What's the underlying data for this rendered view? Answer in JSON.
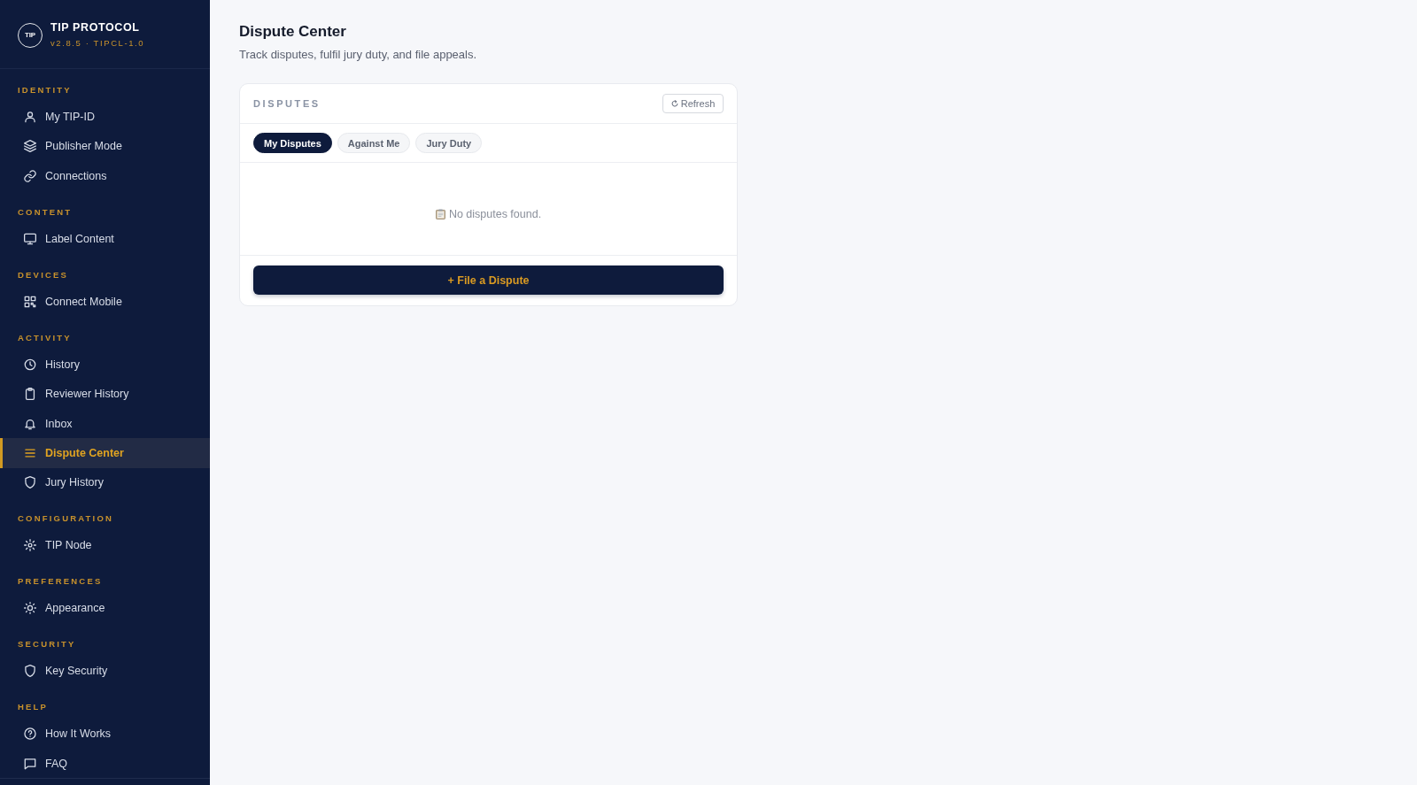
{
  "brand": {
    "logo_text": "TIP",
    "title": "TIP PROTOCOL",
    "version": "v2.8.5 · TIPCL-1.0"
  },
  "sidebar": {
    "sections": [
      {
        "title": "IDENTITY",
        "items": [
          {
            "label": "My TIP-ID",
            "selected": false
          },
          {
            "label": "Publisher Mode",
            "selected": false
          },
          {
            "label": "Connections",
            "selected": false
          }
        ]
      },
      {
        "title": "CONTENT",
        "items": [
          {
            "label": "Label Content",
            "selected": false
          }
        ]
      },
      {
        "title": "DEVICES",
        "items": [
          {
            "label": "Connect Mobile",
            "selected": false
          }
        ]
      },
      {
        "title": "ACTIVITY",
        "items": [
          {
            "label": "History",
            "selected": false
          },
          {
            "label": "Reviewer History",
            "selected": false
          },
          {
            "label": "Inbox",
            "selected": false
          },
          {
            "label": "Dispute Center",
            "selected": true
          },
          {
            "label": "Jury History",
            "selected": false
          }
        ]
      },
      {
        "title": "CONFIGURATION",
        "items": [
          {
            "label": "TIP Node",
            "selected": false
          }
        ]
      },
      {
        "title": "PREFERENCES",
        "items": [
          {
            "label": "Appearance",
            "selected": false
          }
        ]
      },
      {
        "title": "SECURITY",
        "items": [
          {
            "label": "Key Security",
            "selected": false
          }
        ]
      },
      {
        "title": "HELP",
        "items": [
          {
            "label": "How It Works",
            "selected": false
          },
          {
            "label": "FAQ",
            "selected": false
          }
        ]
      }
    ]
  },
  "page": {
    "title": "Dispute Center",
    "subtitle": "Track disputes, fulfil jury duty, and file appeals."
  },
  "disputes_card": {
    "title": "DISPUTES",
    "refresh_button": "Refresh",
    "tabs": [
      {
        "label": "My Disputes",
        "selected": true
      },
      {
        "label": "Against Me",
        "selected": false
      },
      {
        "label": "Jury Duty",
        "selected": false
      }
    ],
    "empty_state": "No disputes found.",
    "file_button": "+ File a Dispute"
  }
}
